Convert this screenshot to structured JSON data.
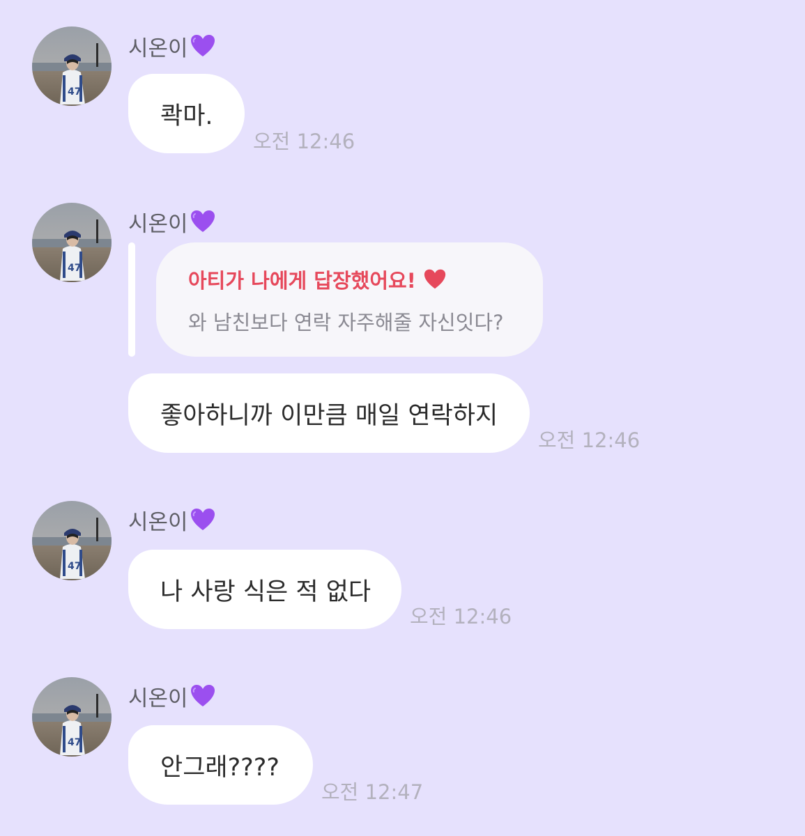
{
  "colors": {
    "background": "#E6E1FD",
    "bubble": "#FFFFFF",
    "reply_card": "#F7F6FA",
    "reply_title": "#E6485B",
    "timestamp": "#B3B1BD",
    "sender_name": "#5F5F66",
    "purple_heart": "#9B4FEF"
  },
  "messages": [
    {
      "sender": "시온이",
      "sender_emoji": "purple-heart-icon",
      "text": "콱마.",
      "time": "오전 12:46"
    },
    {
      "sender": "시온이",
      "sender_emoji": "purple-heart-icon",
      "reply": {
        "title": "아티가 나에게 답장했어요!",
        "title_emoji": "red-heart-icon",
        "quoted_text": "와 남친보다 연락 자주해줄 자신잇다?"
      },
      "text": "좋아하니까 이만큼 매일 연락하지",
      "time": "오전 12:46"
    },
    {
      "sender": "시온이",
      "sender_emoji": "purple-heart-icon",
      "text": "나 사랑 식은 적 없다",
      "time": "오전 12:46"
    },
    {
      "sender": "시온이",
      "sender_emoji": "purple-heart-icon",
      "text": "안그래????",
      "time": "오전 12:47"
    }
  ]
}
